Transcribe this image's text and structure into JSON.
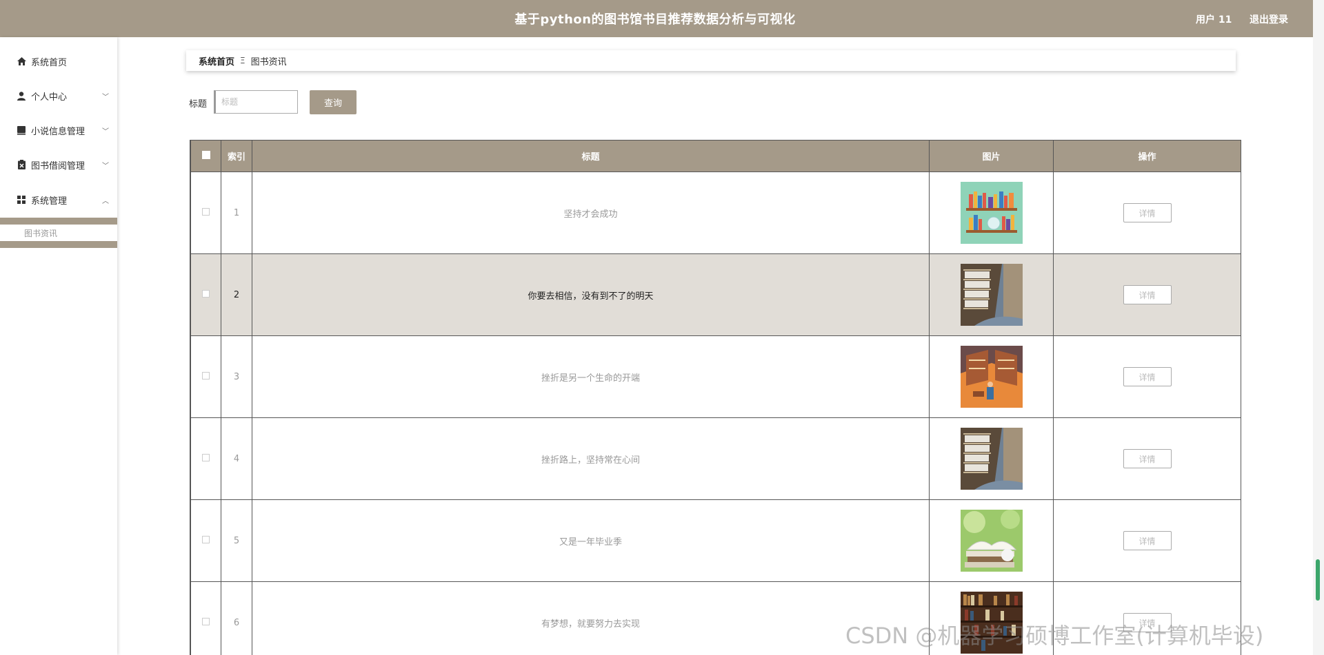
{
  "header": {
    "title": "基于python的图书馆书目推荐数据分析与可视化",
    "user": "用户 11",
    "logout": "退出登录"
  },
  "sidebar": {
    "items": [
      {
        "label": "系统首页",
        "icon": "home-icon",
        "expandable": false
      },
      {
        "label": "个人中心",
        "icon": "user-icon",
        "expandable": true,
        "expanded": false
      },
      {
        "label": "小说信息管理",
        "icon": "book-icon",
        "expandable": true,
        "expanded": false
      },
      {
        "label": "图书借阅管理",
        "icon": "clipboard-icon",
        "expandable": true,
        "expanded": false
      },
      {
        "label": "系统管理",
        "icon": "grid-icon",
        "expandable": true,
        "expanded": true
      }
    ],
    "sub_items": [
      {
        "label": "图书资讯"
      }
    ]
  },
  "breadcrumb": {
    "home": "系统首页",
    "separator": "Ξ",
    "current": "图书资讯"
  },
  "search": {
    "label": "标题",
    "placeholder": "标题",
    "value": "",
    "button": "查询"
  },
  "table": {
    "columns": [
      "索引",
      "标题",
      "图片",
      "操作"
    ],
    "rows": [
      {
        "index": "1",
        "title": "坚持才会成功",
        "image": "bookshelf-illustration",
        "action": "详情"
      },
      {
        "index": "2",
        "title": "你要去相信，没有到不了的明天",
        "image": "library-shelves-photo",
        "action": "详情",
        "highlighted": true
      },
      {
        "index": "3",
        "title": "挫折是另一个生命的开端",
        "image": "library-room-illustration",
        "action": "详情"
      },
      {
        "index": "4",
        "title": "挫折路上，坚持常在心间",
        "image": "library-shelves-photo",
        "action": "详情"
      },
      {
        "index": "5",
        "title": "又是一年毕业季",
        "image": "open-book-photo",
        "action": "详情"
      },
      {
        "index": "6",
        "title": "有梦想，就要努力去实现",
        "image": "bookcase-photo",
        "action": "详情"
      }
    ]
  },
  "watermark": "CSDN @机器学习硕博工作室(计算机毕设)",
  "colors": {
    "primary": "#a59a89",
    "row_highlight": "#e1ddd7"
  }
}
